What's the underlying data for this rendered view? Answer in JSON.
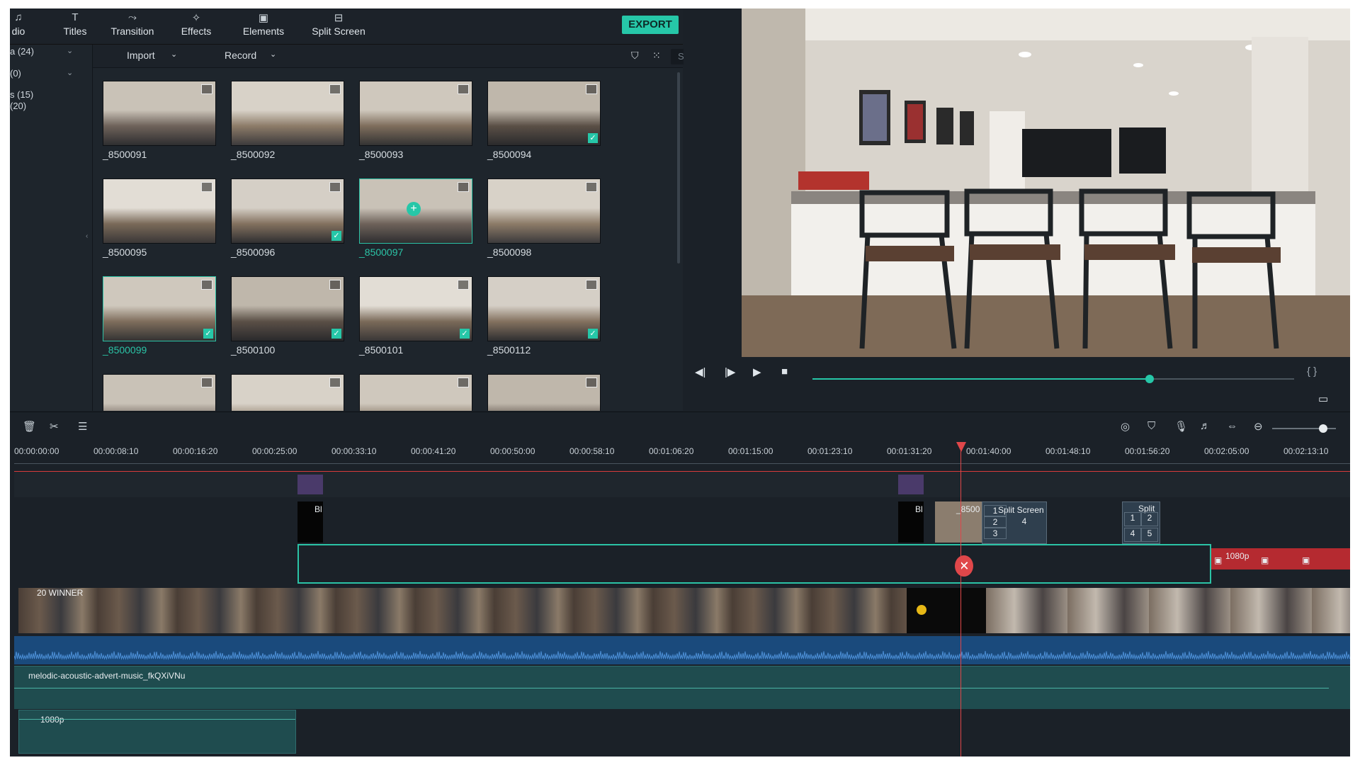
{
  "toolbar": {
    "tabs": [
      {
        "label": "dio",
        "icon": "music-icon"
      },
      {
        "label": "Titles",
        "icon": "titles-icon"
      },
      {
        "label": "Transition",
        "icon": "transition-icon"
      },
      {
        "label": "Effects",
        "icon": "effects-icon"
      },
      {
        "label": "Elements",
        "icon": "elements-icon"
      },
      {
        "label": "Split Screen",
        "icon": "split-screen-icon"
      }
    ],
    "export_label": "EXPORT",
    "accent": "#26c7a8"
  },
  "categories": [
    {
      "label": "a (24)"
    },
    {
      "label": "(0)"
    },
    {
      "label": "s (15)"
    },
    {
      "label": "(20)"
    }
  ],
  "subbar": {
    "import_label": "Import",
    "record_label": "Record",
    "search_placeholder": "Search"
  },
  "media": [
    {
      "name": "_8500091",
      "checked": false,
      "selected": false
    },
    {
      "name": "_8500092",
      "checked": false,
      "selected": false
    },
    {
      "name": "_8500093",
      "checked": false,
      "selected": false
    },
    {
      "name": "_8500094",
      "checked": true,
      "selected": false
    },
    {
      "name": "_8500095",
      "checked": false,
      "selected": false
    },
    {
      "name": "_8500096",
      "checked": true,
      "selected": false
    },
    {
      "name": "_8500097",
      "checked": false,
      "selected": true
    },
    {
      "name": "_8500098",
      "checked": false,
      "selected": false
    },
    {
      "name": "_8500099",
      "checked": true,
      "selected": true
    },
    {
      "name": "_8500100",
      "checked": true,
      "selected": false
    },
    {
      "name": "_8500101",
      "checked": true,
      "selected": false
    },
    {
      "name": "_8500112",
      "checked": true,
      "selected": false
    },
    {
      "name": "",
      "checked": false,
      "selected": false
    },
    {
      "name": "",
      "checked": false,
      "selected": false
    },
    {
      "name": "",
      "checked": false,
      "selected": false
    },
    {
      "name": "",
      "checked": false,
      "selected": false
    }
  ],
  "preview": {
    "progress": 0.7,
    "brackets": "{ }"
  },
  "timeline": {
    "ticks": [
      "00:00:00:00",
      "00:00:08:10",
      "00:00:16:20",
      "00:00:25:00",
      "00:00:33:10",
      "00:00:41:20",
      "00:00:50:00",
      "00:00:58:10",
      "00:01:06:20",
      "00:01:15:00",
      "00:01:23:10",
      "00:01:31:20",
      "00:01:40:00",
      "00:01:48:10",
      "00:01:56:20",
      "00:02:05:00",
      "00:02:13:10"
    ],
    "zoom": 0.8,
    "clips": {
      "black1": "Bl",
      "black2": "Bl",
      "clip_8500": "_8500",
      "split_screen": "Split Screen",
      "split_nums": [
        "1",
        "2",
        "3",
        "4"
      ],
      "split2": "Split",
      "split2_nums": [
        "1",
        "2",
        "4",
        "5"
      ],
      "res_1080_a": "1080p",
      "video_label": "20 WINNER",
      "music": "melodic-acoustic-advert-music_fkQXiVNu",
      "res_1080_b": "1080p"
    }
  }
}
